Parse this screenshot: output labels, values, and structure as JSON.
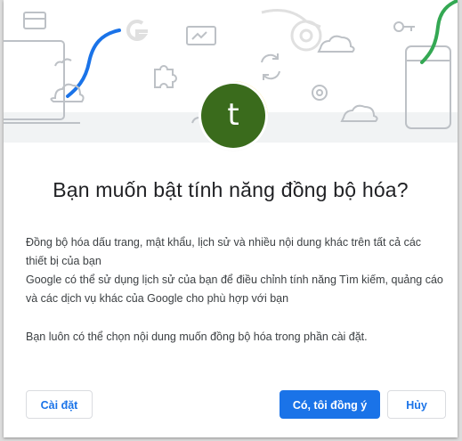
{
  "dialog": {
    "avatar_letter": "t",
    "title": "Bạn muốn bật tính năng đồng bộ hóa?",
    "line1": "Đồng bộ hóa dấu trang, mật khẩu, lịch sử và nhiều nội dung khác trên tất cả các thiết bị của bạn",
    "line2": "Google có thể sử dụng lịch sử của bạn để điều chỉnh tính năng Tìm kiếm, quảng cáo và các dịch vụ khác của Google cho phù hợp với bạn",
    "note": "Bạn luôn có thể chọn nội dung muốn đồng bộ hóa trong phần cài đặt."
  },
  "buttons": {
    "settings": "Cài đặt",
    "accept": "Có, tôi đồng ý",
    "cancel": "Hủy"
  },
  "colors": {
    "accent": "#1a73e8",
    "avatar_bg": "#3a6b1c",
    "accent_green": "#34a853",
    "accent_yellow": "#fbbc04"
  },
  "illustration_icons": [
    "laptop-icon",
    "window-icon",
    "google-logo-icon",
    "chrome-logo-icon",
    "key-icon",
    "puzzle-icon",
    "sync-icon",
    "gear-icon",
    "phone-icon",
    "cloud-icon"
  ]
}
